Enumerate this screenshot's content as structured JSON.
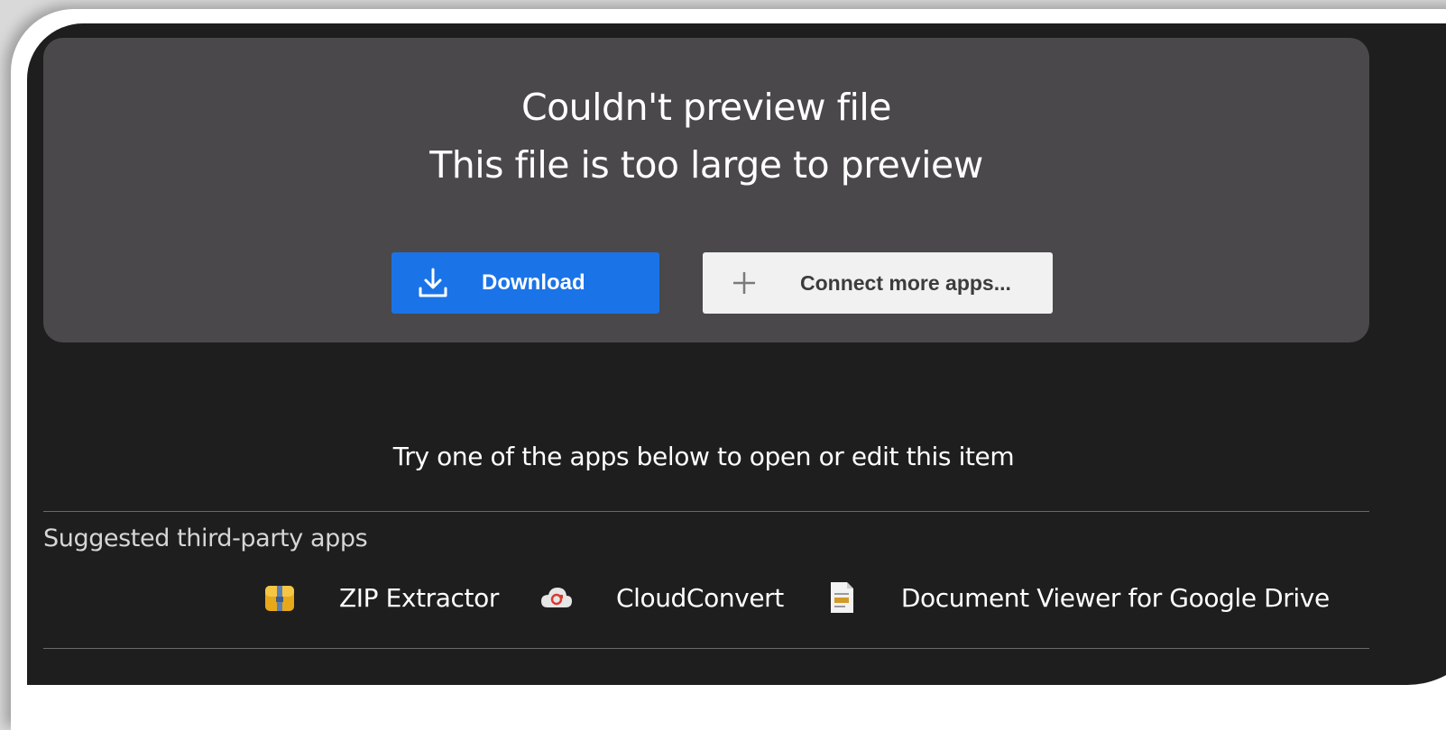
{
  "preview": {
    "title": "Couldn't preview file",
    "subtitle": "This file is too large to preview"
  },
  "actions": {
    "download_label": "Download",
    "download_icon": "download-icon",
    "connect_label": "Connect more apps...",
    "connect_icon": "plus-icon"
  },
  "hint": {
    "text": "Try one of the apps below to open or edit this item"
  },
  "suggested": {
    "heading": "Suggested third-party apps",
    "apps": [
      {
        "name": "ZIP Extractor",
        "icon": "zip-extractor-icon"
      },
      {
        "name": "CloudConvert",
        "icon": "cloudconvert-icon"
      },
      {
        "name": "Document Viewer for Google Drive",
        "icon": "document-viewer-icon"
      }
    ]
  },
  "colors": {
    "background": "#1e1e1e",
    "card": "#4a484b",
    "primary": "#1b73e8",
    "secondary_button": "#f1f1f1"
  }
}
